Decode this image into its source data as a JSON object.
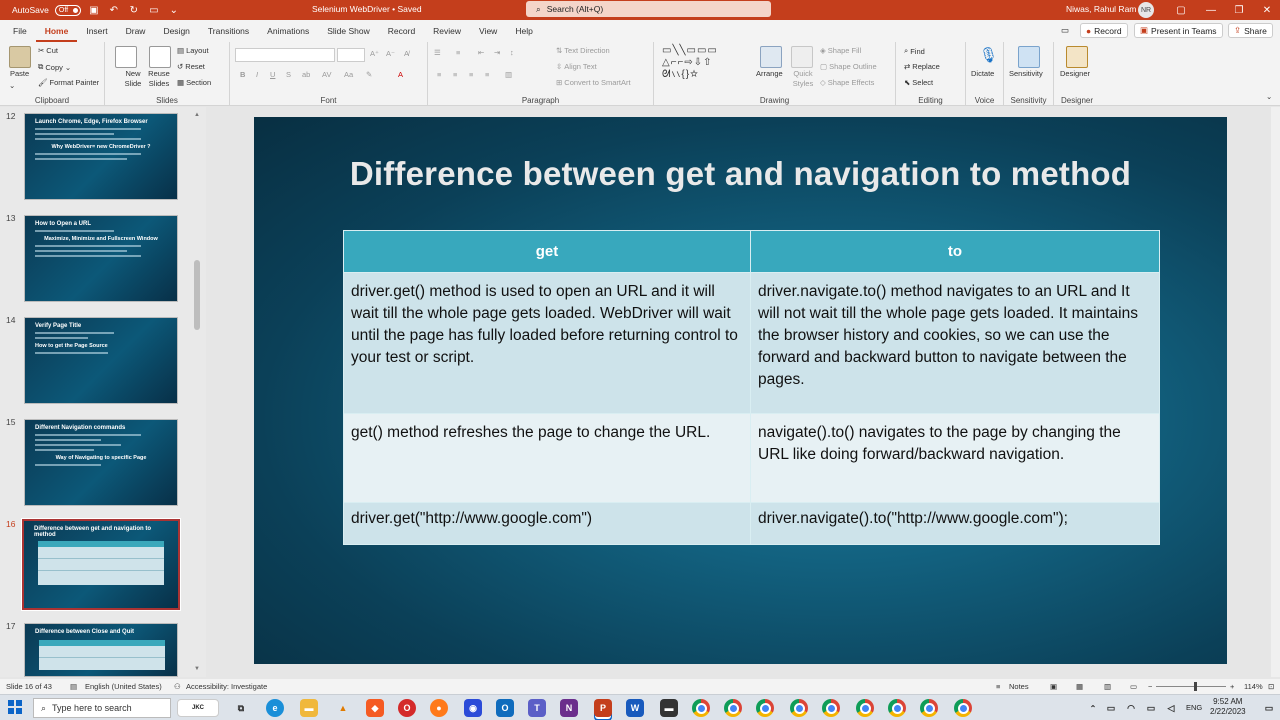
{
  "titlebar": {
    "autosave_label": "AutoSave",
    "autosave_state": "Off",
    "doc_title": "Selenium WebDriver • Saved",
    "search_placeholder": "Search (Alt+Q)",
    "user_name": "Niwas, Rahul Ram",
    "user_initials": "NR"
  },
  "tabs": [
    "File",
    "Home",
    "Insert",
    "Draw",
    "Design",
    "Transitions",
    "Animations",
    "Slide Show",
    "Record",
    "Review",
    "View",
    "Help"
  ],
  "active_tab": "Home",
  "right_buttons": {
    "record": "Record",
    "present": "Present in Teams",
    "share": "Share"
  },
  "ribbon": {
    "clipboard": {
      "label": "Clipboard",
      "paste": "Paste",
      "cut": "Cut",
      "copy": "Copy",
      "format_painter": "Format Painter"
    },
    "slides": {
      "label": "Slides",
      "new_slide": "New Slide",
      "reuse_slides": "Reuse Slides",
      "layout": "Layout",
      "reset": "Reset",
      "section": "Section"
    },
    "font": {
      "label": "Font"
    },
    "paragraph": {
      "label": "Paragraph",
      "text_direction": "Text Direction",
      "align_text": "Align Text",
      "convert_smartart": "Convert to SmartArt"
    },
    "drawing": {
      "label": "Drawing",
      "arrange": "Arrange",
      "quick_styles": "Quick Styles",
      "shape_fill": "Shape Fill",
      "shape_outline": "Shape Outline",
      "shape_effects": "Shape Effects"
    },
    "editing": {
      "label": "Editing",
      "find": "Find",
      "replace": "Replace",
      "select": "Select"
    },
    "voice": {
      "label": "Voice",
      "dictate": "Dictate"
    },
    "sensitivity": {
      "label": "Sensitivity",
      "btn": "Sensitivity"
    },
    "designer": {
      "label": "Designer",
      "btn": "Designer"
    }
  },
  "thumbnails": [
    {
      "num": "12",
      "title": "Launch Chrome, Edge, Firefox Browser",
      "subtitle": "Why WebDriver= new ChromeDriver ?"
    },
    {
      "num": "13",
      "title": "How to Open a URL",
      "subtitle": "Maximize, Minimize and Fullscreen Window"
    },
    {
      "num": "14",
      "title": "Verify Page Title",
      "subtitle": "How to get the Page Source"
    },
    {
      "num": "15",
      "title": "Different Navigation commands",
      "subtitle": "Way of Navigating to specific Page"
    },
    {
      "num": "16",
      "title": "Difference between get and navigation to method",
      "subtitle": ""
    },
    {
      "num": "17",
      "title": "Difference between Close and Quit",
      "subtitle": ""
    }
  ],
  "slide": {
    "title": "Difference between get and navigation to method",
    "headers": [
      "get",
      "to"
    ],
    "rows": [
      [
        "driver.get() method is used to open an URL and it will wait till the whole page gets loaded. WebDriver will wait until the page has fully loaded before returning control to your test or script.",
        "driver.navigate.to() method navigates to an URL and It will not wait till the whole page gets loaded. It maintains the browser history and cookies, so we can use the forward and backward button to navigate between the pages."
      ],
      [
        "get() method refreshes the page to change the URL.",
        "navigate().to() navigates to the page by changing the URL like doing forward/backward navigation."
      ],
      [
        "driver.get(\"http://www.google.com\")",
        "driver.navigate().to(\"http://www.google.com\");"
      ]
    ]
  },
  "status": {
    "slide_of": "Slide 16 of 43",
    "language": "English (United States)",
    "accessibility": "Accessibility: Investigate",
    "notes": "Notes",
    "zoom": "114%"
  },
  "taskbar": {
    "search_placeholder": "Type here to search",
    "lang": "ENG",
    "time": "9:52 AM",
    "date": "2/22/2023"
  },
  "colors": {
    "accent": "#c43e1c",
    "table_header": "#38a8bd",
    "slide_bg": "#0b4058"
  }
}
